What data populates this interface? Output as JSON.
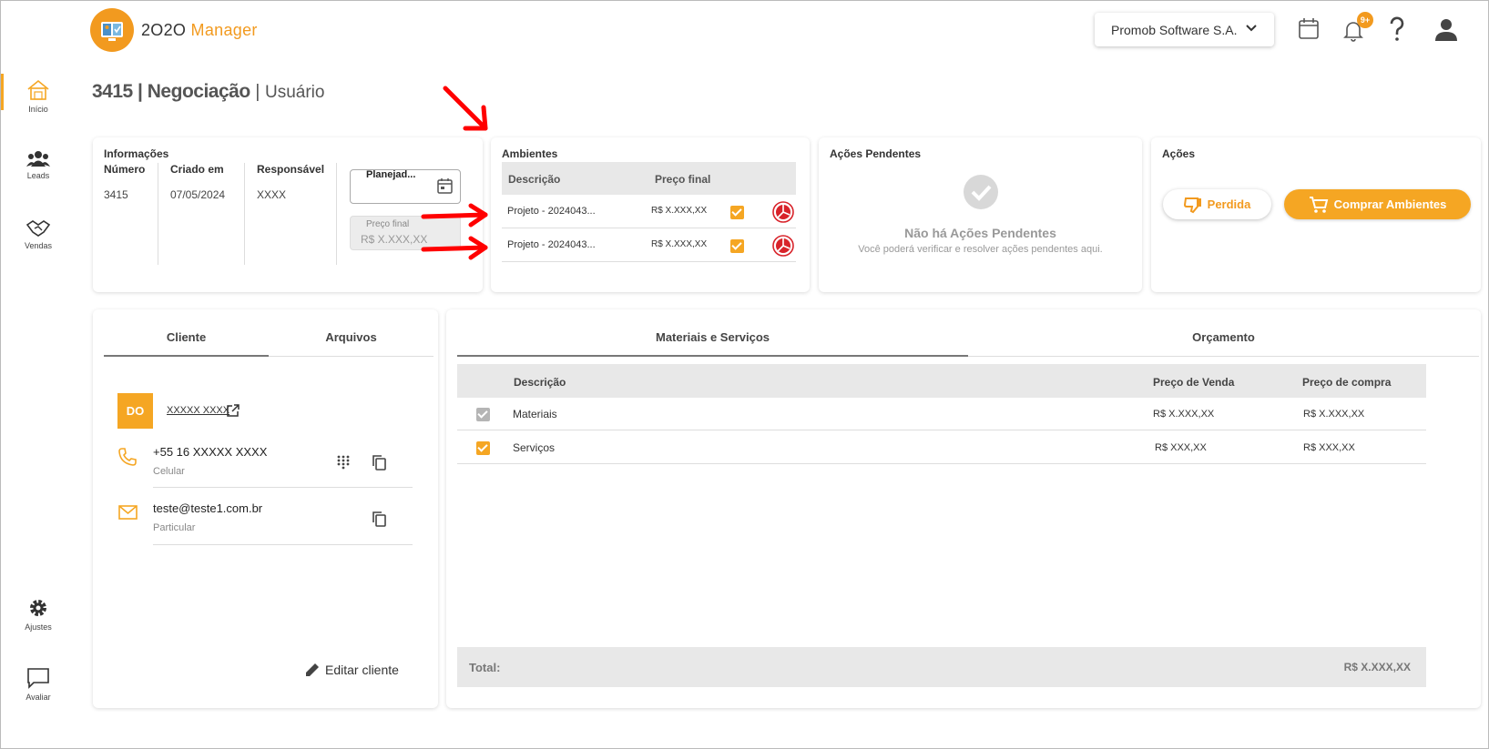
{
  "app": {
    "logo_prefix": "2O2O",
    "logo_suffix": "Manager",
    "company": "Promob Software S.A.",
    "notification_badge": "9+"
  },
  "sidebar": {
    "items": [
      {
        "label": "Início",
        "icon": "home-icon"
      },
      {
        "label": "Leads",
        "icon": "people-icon"
      },
      {
        "label": "Vendas",
        "icon": "handshake-icon"
      },
      {
        "label": "Ajustes",
        "icon": "gear-icon"
      },
      {
        "label": "Avaliar",
        "icon": "chat-icon"
      }
    ]
  },
  "page": {
    "id": "3415",
    "section": "Negociação",
    "user": "Usuário"
  },
  "info": {
    "title": "Informações",
    "numero_label": "Número",
    "numero": "3415",
    "criado_label": "Criado em",
    "criado": "07/05/2024",
    "responsavel_label": "Responsável",
    "responsavel": "XXXX",
    "planejado_label": "Planejad...",
    "preco_final_label": "Preço final",
    "preco_final_value": "R$ X.XXX,XX"
  },
  "ambientes": {
    "title": "Ambientes",
    "col_descricao": "Descrição",
    "col_preco": "Preço final",
    "rows": [
      {
        "descricao": "Projeto - 2024043...",
        "preco": "R$ X.XXX,XX"
      },
      {
        "descricao": "Projeto - 2024043...",
        "preco": "R$ X.XXX,XX"
      }
    ]
  },
  "pendentes": {
    "title": "Ações Pendentes",
    "empty_title": "Não há Ações Pendentes",
    "empty_subtitle": "Você poderá verificar e resolver ações pendentes aqui."
  },
  "acoes": {
    "title": "Ações",
    "perdida": "Perdida",
    "comprar": "Comprar Ambientes"
  },
  "client_panel": {
    "tab_cliente": "Cliente",
    "tab_arquivos": "Arquivos",
    "avatar_initials": "DO",
    "name": "XXXXX XXXX",
    "phone": "+55 16 XXXXX XXXX",
    "phone_type": "Celular",
    "email": "teste@teste1.com.br",
    "email_type": "Particular",
    "edit_label": "Editar cliente"
  },
  "materials": {
    "tab_materiais": "Materiais e Serviços",
    "tab_orcamento": "Orçamento",
    "col_descricao": "Descrição",
    "col_venda": "Preço de Venda",
    "col_compra": "Preço de compra",
    "rows": [
      {
        "descricao": "Materiais",
        "venda": "R$ X.XXX,XX",
        "compra": "R$ X.XXX,XX"
      },
      {
        "descricao": "Serviços",
        "venda": "R$ XXX,XX",
        "compra": "R$ XXX,XX"
      }
    ],
    "total_label": "Total:",
    "total_value": "R$ X.XXX,XX"
  },
  "colors": {
    "accent": "#f5a623",
    "annotation": "#ff0000"
  }
}
